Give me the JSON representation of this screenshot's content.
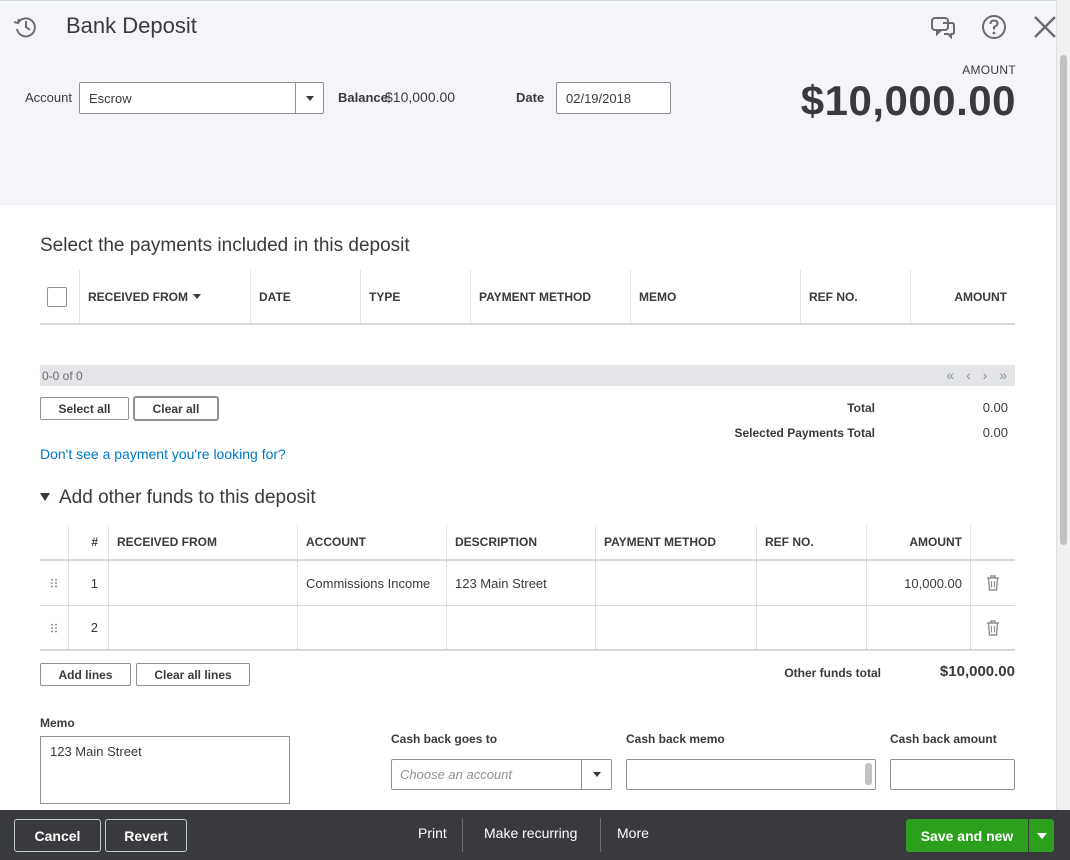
{
  "header": {
    "title": "Bank Deposit",
    "account_label": "Account",
    "account_value": "Escrow",
    "balance_label": "Balance",
    "balance_value": "$10,000.00",
    "date_label": "Date",
    "date_value": "02/19/2018",
    "amount_label": "AMOUNT",
    "amount_value": "$10,000.00"
  },
  "payments": {
    "title": "Select the payments included in this deposit",
    "columns": [
      "RECEIVED FROM",
      "DATE",
      "TYPE",
      "PAYMENT METHOD",
      "MEMO",
      "REF NO.",
      "AMOUNT"
    ],
    "pager_text": "0-0 of 0",
    "pager_nav": "« ‹ › »",
    "select_all": "Select all",
    "clear_all": "Clear all",
    "total_label": "Total",
    "total_value": "0.00",
    "selected_total_label": "Selected Payments Total",
    "selected_total_value": "0.00",
    "missing_link": "Don't see a payment you're looking for?"
  },
  "other_funds": {
    "title": "Add other funds to this deposit",
    "columns": [
      "#",
      "RECEIVED FROM",
      "ACCOUNT",
      "DESCRIPTION",
      "PAYMENT METHOD",
      "REF NO.",
      "AMOUNT"
    ],
    "rows": [
      {
        "num": "1",
        "received_from": "",
        "account": "Commissions Income",
        "description": "123 Main Street",
        "payment_method": "",
        "ref_no": "",
        "amount": "10,000.00"
      },
      {
        "num": "2",
        "received_from": "",
        "account": "",
        "description": "",
        "payment_method": "",
        "ref_no": "",
        "amount": ""
      }
    ],
    "add_lines": "Add lines",
    "clear_all_lines": "Clear all lines",
    "total_label": "Other funds total",
    "total_value": "$10,000.00"
  },
  "memo": {
    "label": "Memo",
    "value": "123 Main Street"
  },
  "cash_back": {
    "goes_to_label": "Cash back goes to",
    "goes_to_placeholder": "Choose an account",
    "memo_label": "Cash back memo",
    "amount_label": "Cash back amount"
  },
  "footer": {
    "cancel": "Cancel",
    "revert": "Revert",
    "print": "Print",
    "make_recurring": "Make recurring",
    "more": "More",
    "save_and_new": "Save and new"
  },
  "colors": {
    "accent_green": "#2ca01c",
    "link_blue": "#0077c5",
    "footer_bg": "#393a3d"
  }
}
